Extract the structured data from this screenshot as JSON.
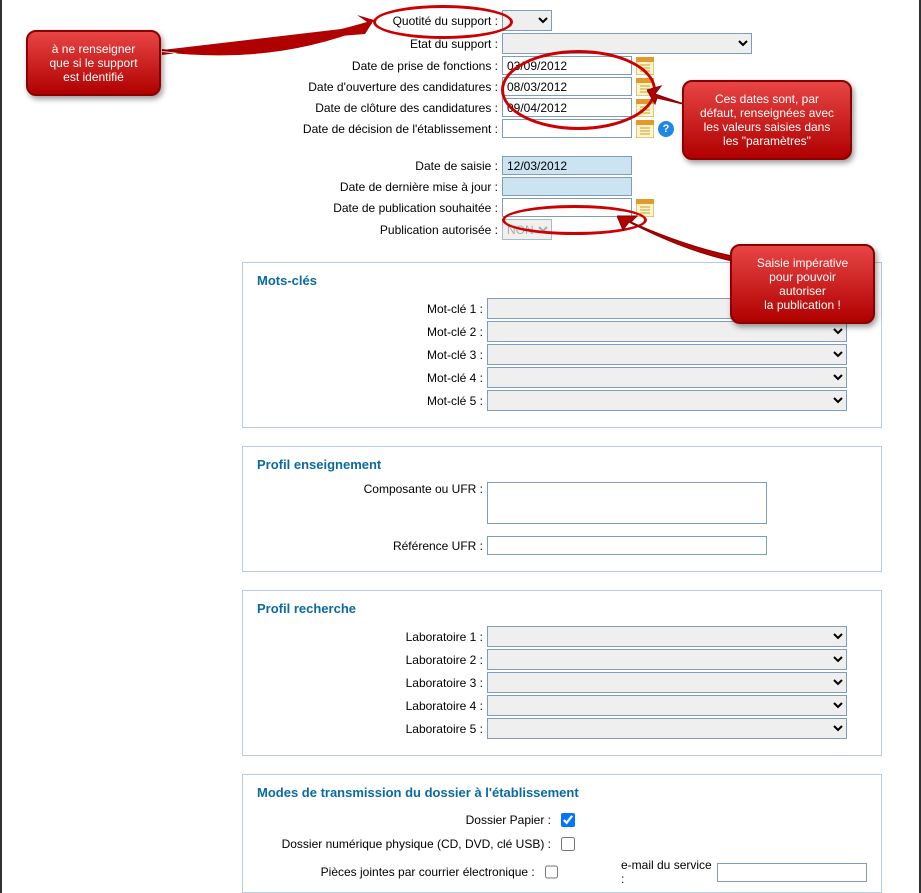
{
  "top": {
    "quotite_support_label": "Quotité du support :",
    "etat_support_label": "Etat du support :",
    "date_prise_fonctions_label": "Date de prise de fonctions :",
    "date_prise_fonctions_value": "03/09/2012",
    "date_ouverture_label": "Date d'ouverture des candidatures :",
    "date_ouverture_value": "08/03/2012",
    "date_cloture_label": "Date de clôture des candidatures :",
    "date_cloture_value": "09/04/2012",
    "date_decision_label": "Date de décision de l'établissement :",
    "date_decision_value": "",
    "date_saisie_label": "Date de saisie :",
    "date_saisie_value": "12/03/2012",
    "date_maj_label": "Date de dernière mise à jour :",
    "date_maj_value": "",
    "date_pub_label": "Date de publication souhaitée :",
    "date_pub_value": "",
    "pub_autorisee_label": "Publication autorisée :",
    "pub_autorisee_value": "NON"
  },
  "motscles": {
    "title": "Mots-clés",
    "m1_label": "Mot-clé 1 :",
    "m2_label": "Mot-clé 2 :",
    "m3_label": "Mot-clé 3 :",
    "m4_label": "Mot-clé 4 :",
    "m5_label": "Mot-clé 5 :"
  },
  "profil_ens": {
    "title": "Profil enseignement",
    "composante_label": "Composante ou UFR :",
    "ref_label": "Référence UFR :"
  },
  "profil_rech": {
    "title": "Profil recherche",
    "l1_label": "Laboratoire 1 :",
    "l2_label": "Laboratoire 2 :",
    "l3_label": "Laboratoire 3 :",
    "l4_label": "Laboratoire 4 :",
    "l5_label": "Laboratoire 5 :"
  },
  "modes": {
    "title": "Modes de transmission du dossier à l'établissement",
    "dossier_papier_label": "Dossier Papier :",
    "dossier_num_label": "Dossier numérique physique (CD, DVD, clé USB) :",
    "pj_email_label": "Pièces jointes par courrier électronique :",
    "email_service_label": "e-mail du service :"
  },
  "callouts": {
    "c1": "à ne renseigner\nque si le support\nest identifié",
    "c2": "Ces dates sont, par\ndéfaut, renseignées avec\nles valeurs saisies dans\nles \"paramètres\"",
    "c3": "Saisie impérative\npour pouvoir autoriser\nla publication !"
  }
}
